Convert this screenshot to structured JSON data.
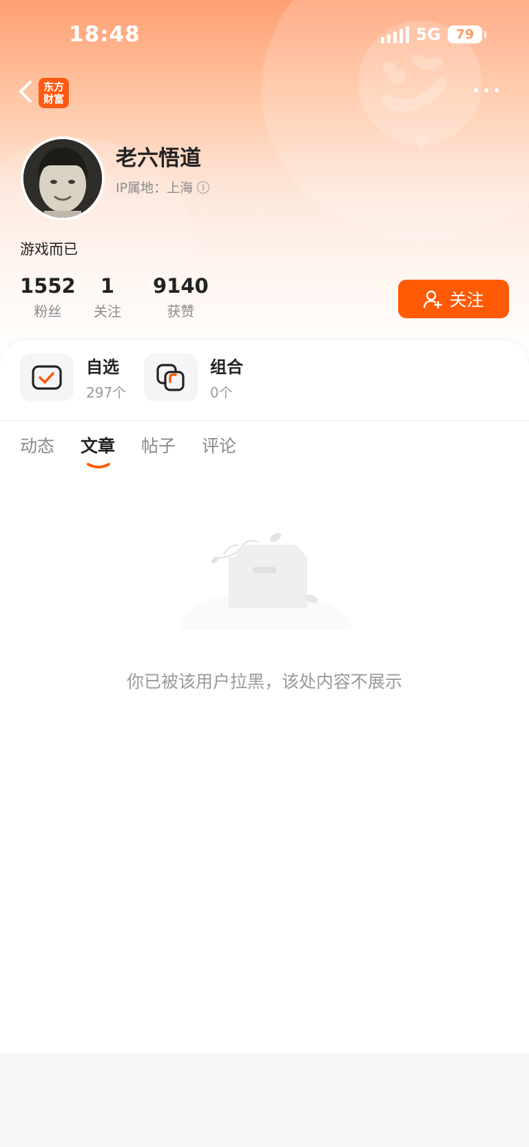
{
  "status_bar": {
    "time": "18:48",
    "network": "5G",
    "battery": "79"
  },
  "header": {
    "back_icon": "chevron-left-icon",
    "app_logo_text": "东方财富",
    "app_logo_line1": "东方",
    "app_logo_line2": "财富",
    "more_icon": "more-dots-icon",
    "accent_color": "#ff5a06"
  },
  "profile": {
    "username": "老六悟道",
    "ip_location": "IP属地：上海",
    "bio": "游戏而已",
    "stats": [
      {
        "value": "1552",
        "label": "粉丝"
      },
      {
        "value": "1",
        "label": "关注"
      },
      {
        "value": "9140",
        "label": "获赞"
      }
    ],
    "follow_button": "关注"
  },
  "shortcuts": [
    {
      "title": "自选",
      "count": "297个",
      "icon": "watchlist-check-icon"
    },
    {
      "title": "组合",
      "count": "0个",
      "icon": "portfolio-stack-icon"
    }
  ],
  "tabs": [
    {
      "label": "动态",
      "active": false
    },
    {
      "label": "文章",
      "active": true
    },
    {
      "label": "帖子",
      "active": false
    },
    {
      "label": "评论",
      "active": false
    }
  ],
  "empty_state": {
    "icon": "empty-box-icon",
    "message": "你已被该用户拉黑，该处内容不展示"
  }
}
